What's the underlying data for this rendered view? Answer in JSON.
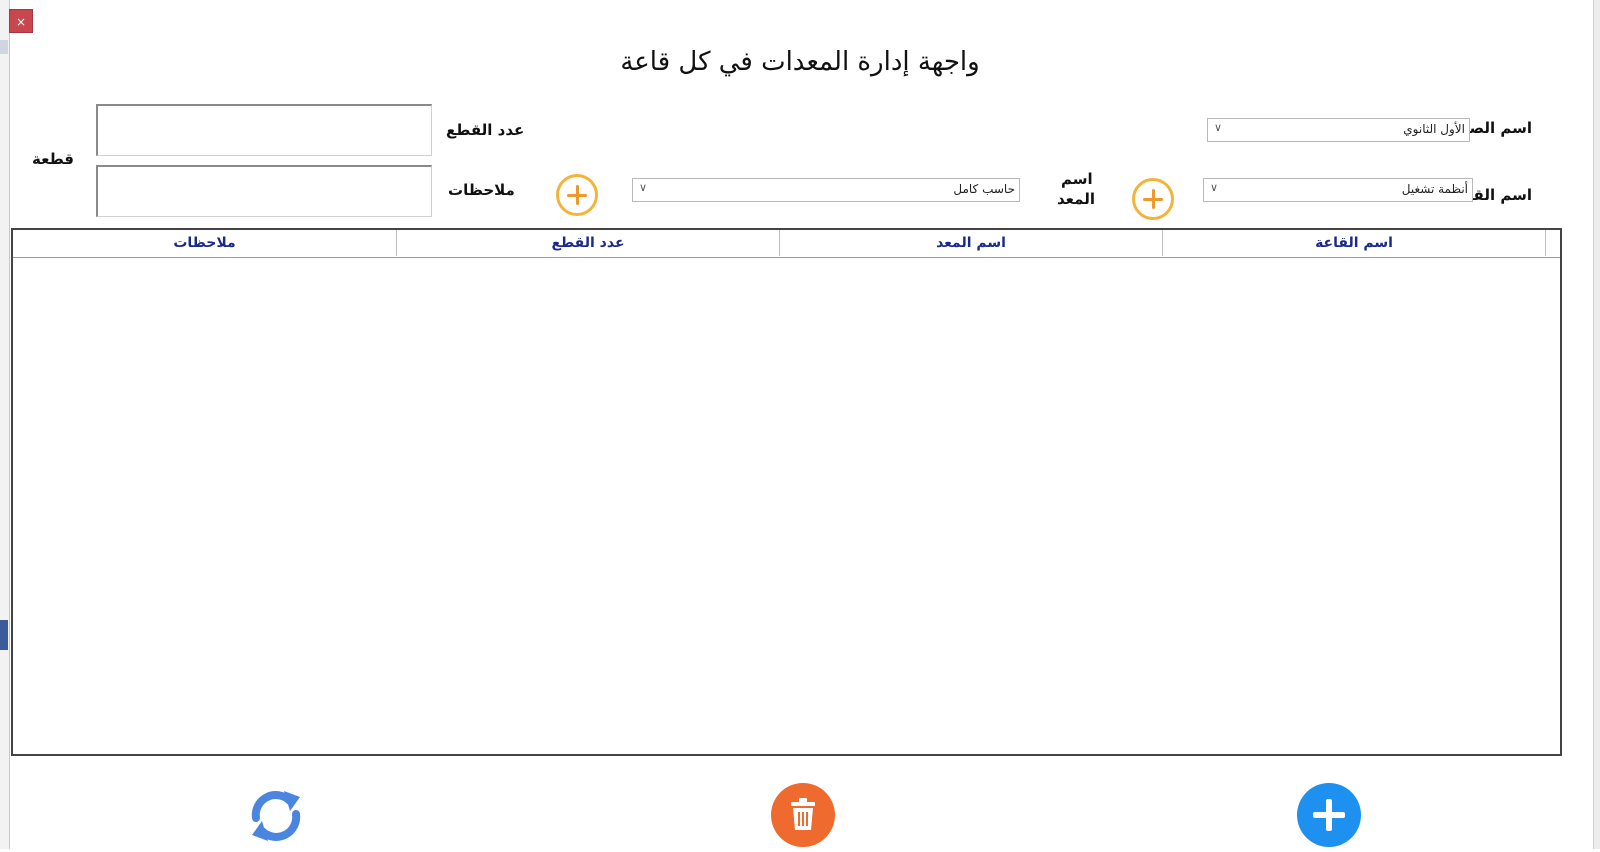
{
  "window": {
    "title": "واجهة إدارة المعدات في كل قاعة",
    "close_glyph": "×"
  },
  "form": {
    "class_label": "اسم الصف",
    "class_value": "الأول الثانوي",
    "room_label": "اسم القاعة",
    "room_value": "أنظمة تشغيل",
    "equipment_label_line1": "اسم",
    "equipment_label_line2": "المعد",
    "equipment_value": "حاسب كامل",
    "pieces_label": "عدد القطع",
    "notes_label": "ملاحظات",
    "unit_label": "قطعة",
    "pieces_value": "",
    "notes_value": ""
  },
  "table": {
    "columns": [
      "اسم القاعة",
      "اسم المعد",
      "عدد القطع",
      "ملاحظات"
    ],
    "rows": []
  },
  "icons": {
    "add_room": "plus-circle-icon",
    "add_equipment": "plus-circle-icon",
    "add": "add-icon",
    "delete": "trash-icon",
    "refresh": "refresh-icon"
  },
  "colors": {
    "add_button": "#1e90f0",
    "delete_button": "#ef6a2e",
    "refresh_icon": "#4a86e0",
    "plus_outline": "#f3b43a",
    "header_text": "#1a2a8a",
    "close_button": "#c8474e"
  }
}
